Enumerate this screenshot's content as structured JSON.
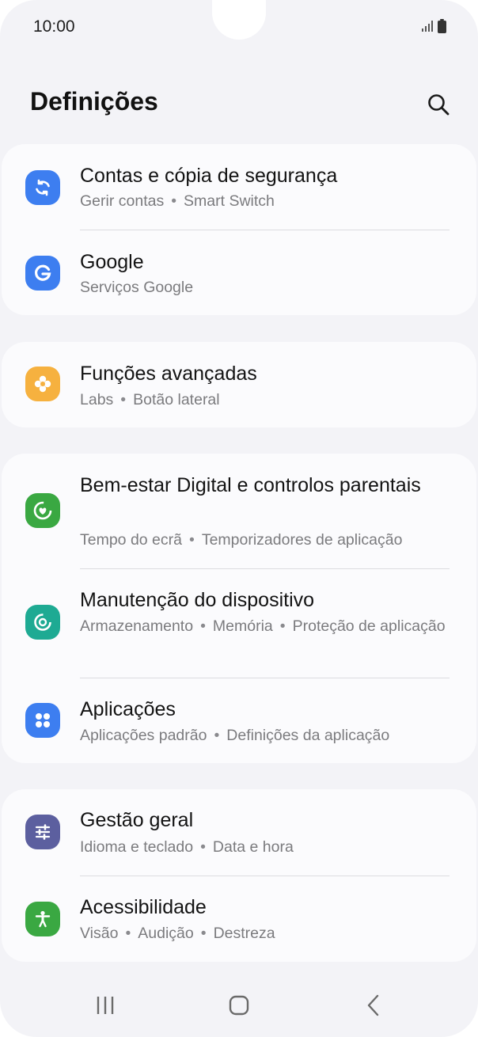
{
  "status_bar": {
    "time": "10:00"
  },
  "header": {
    "title": "Definições"
  },
  "colors": {
    "accounts_icon": "#3d7ef0",
    "google_icon": "#3d7ef0",
    "advanced_icon": "#f6b13f",
    "wellbeing_icon": "#3aa842",
    "maintenance_icon": "#1eaa93",
    "apps_icon": "#3d7ef0",
    "general_icon": "#5c5f9f",
    "accessibility_icon": "#3aa842"
  },
  "settings": {
    "accounts": {
      "title": "Contas e cópia de segurança",
      "sub1": "Gerir contas",
      "sub2": "Smart Switch",
      "icon": "sync-icon"
    },
    "google": {
      "title": "Google",
      "sub1": "Serviços Google",
      "icon": "google-g-icon"
    },
    "advanced": {
      "title": "Funções avançadas",
      "sub1": "Labs",
      "sub2": "Botão lateral",
      "icon": "puzzle-icon"
    },
    "wellbeing": {
      "title": "Bem-estar Digital e controlos parentais",
      "sub1": "Tempo do ecrã",
      "sub2": "Temporizadores de aplicação",
      "icon": "heart-circle-icon"
    },
    "maintenance": {
      "title": "Manutenção do dispositivo",
      "sub1": "Armazenamento",
      "sub2": "Memória",
      "sub3": "Proteção de aplicação",
      "icon": "device-care-icon"
    },
    "apps": {
      "title": "Aplicações",
      "sub1": "Aplicações padrão",
      "sub2": "Definições da aplicação",
      "icon": "apps-grid-icon"
    },
    "general": {
      "title": "Gestão geral",
      "sub1": "Idioma e teclado",
      "sub2": "Data e hora",
      "icon": "sliders-icon"
    },
    "accessibility": {
      "title": "Acessibilidade",
      "sub1": "Visão",
      "sub2": "Audição",
      "sub3": "Destreza",
      "icon": "accessibility-person-icon"
    }
  },
  "nav": {
    "recents": "recents-icon",
    "home": "home-icon",
    "back": "back-icon"
  }
}
